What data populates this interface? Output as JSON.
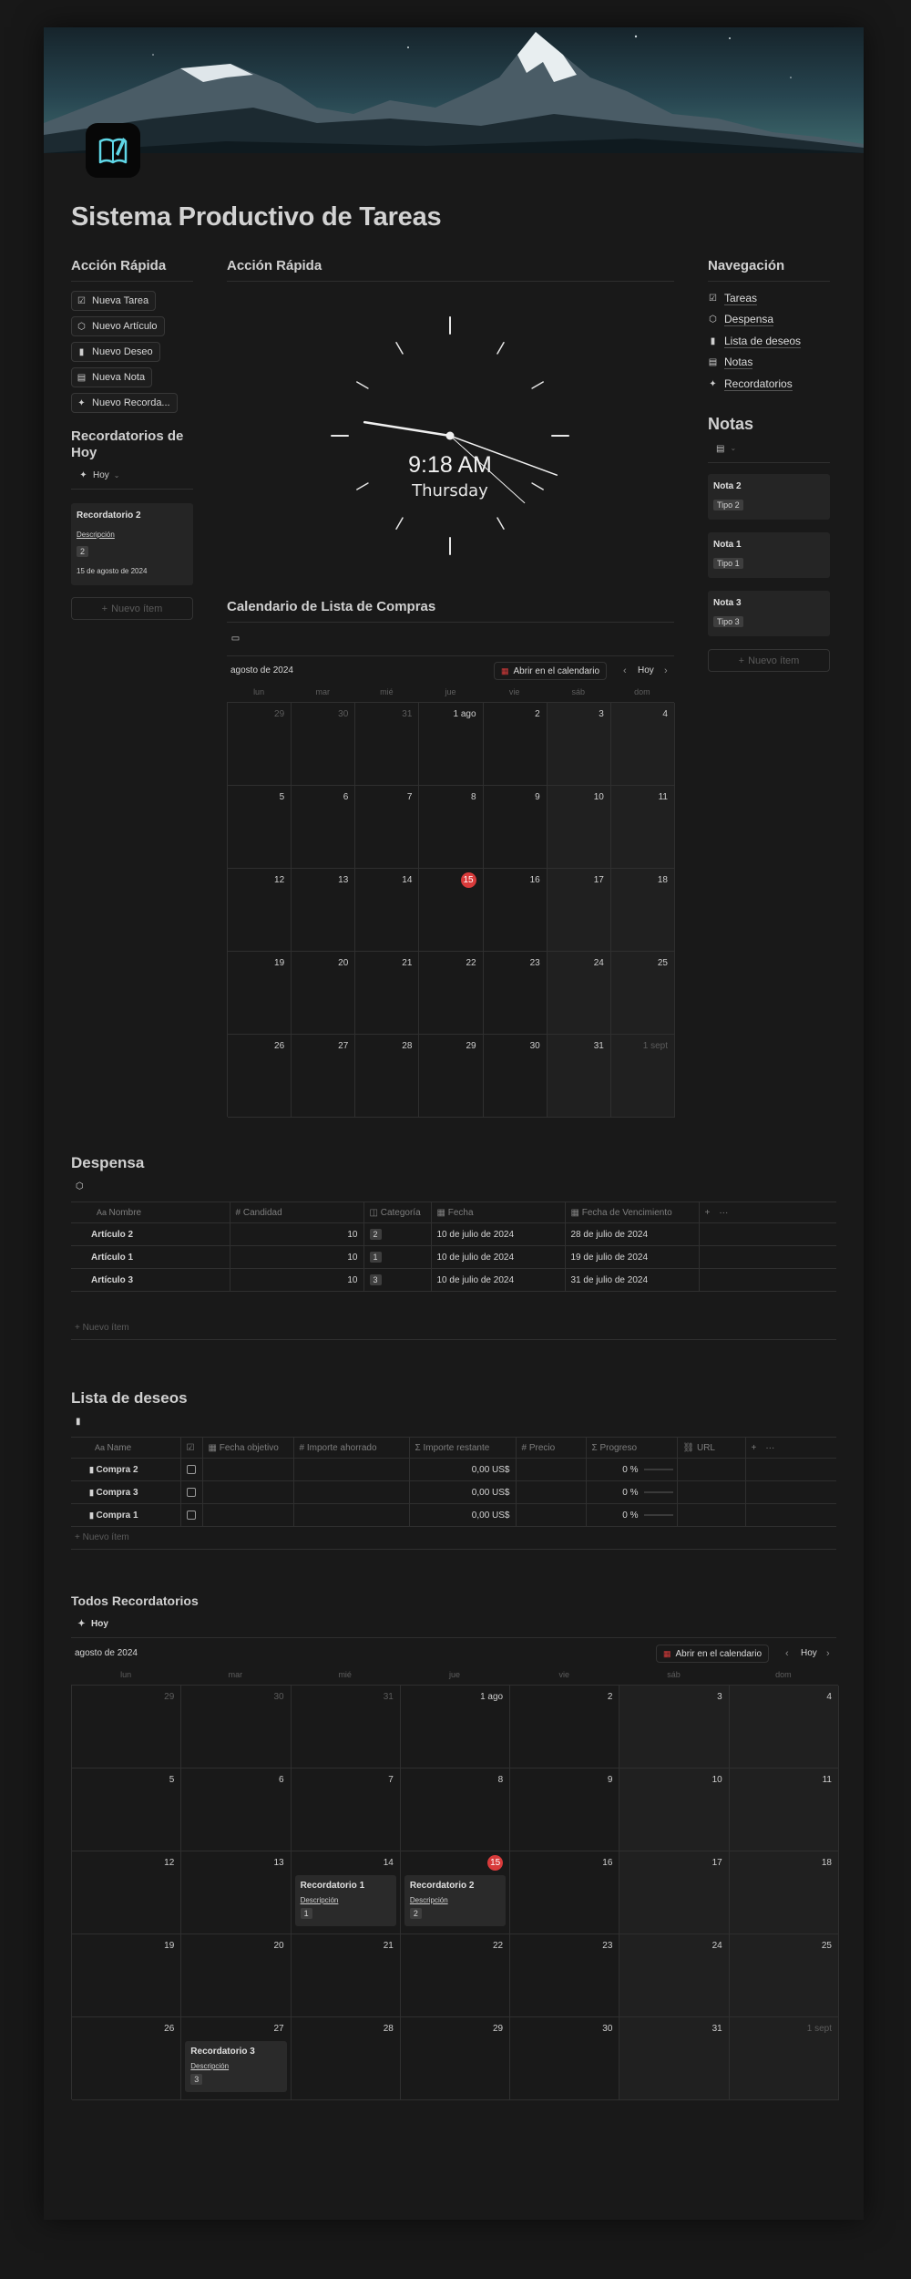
{
  "page": {
    "title": "Sistema Productivo de Tareas"
  },
  "quick_actions": {
    "heading": "Acción Rápida",
    "buttons": [
      {
        "label": "Nueva Tarea",
        "icon": "checkbox-icon"
      },
      {
        "label": "Nuevo Artículo",
        "icon": "box-icon"
      },
      {
        "label": "Nuevo Deseo",
        "icon": "bag-icon"
      },
      {
        "label": "Nueva Nota",
        "icon": "note-icon"
      },
      {
        "label": "Nuevo Recorda...",
        "icon": "reminder-icon"
      }
    ]
  },
  "today_reminders": {
    "heading": "Recordatorios de Hoy",
    "filter": "Hoy",
    "card": {
      "title": "Recordatorio 2",
      "desc_label": "Descripción",
      "badge": "2",
      "date": "15 de agosto de 2024"
    },
    "new_item": "Nuevo ítem"
  },
  "clock": {
    "heading": "Acción Rápida",
    "time": "9:18 AM",
    "day": "Thursday",
    "hour": 9,
    "minute": 18,
    "second": 22
  },
  "navigation": {
    "heading": "Navegación",
    "items": [
      {
        "label": "Tareas",
        "icon": "checkbox-icon"
      },
      {
        "label": "Despensa",
        "icon": "box-icon"
      },
      {
        "label": "Lista de deseos",
        "icon": "bag-icon"
      },
      {
        "label": "Notas",
        "icon": "note-icon"
      },
      {
        "label": "Recordatorios",
        "icon": "reminder-icon"
      }
    ]
  },
  "notes": {
    "heading": "Notas",
    "cards": [
      {
        "title": "Nota 2",
        "tag": "Tipo 2"
      },
      {
        "title": "Nota 1",
        "tag": "Tipo 1"
      },
      {
        "title": "Nota 3",
        "tag": "Tipo 3"
      }
    ],
    "new_item": "Nuevo ítem"
  },
  "shopping_calendar": {
    "heading": "Calendario de Lista de Compras",
    "month": "agosto de 2024",
    "open_btn": "Abrir en el calendario",
    "today_btn": "Hoy",
    "weekdays": [
      "lun",
      "mar",
      "mié",
      "jue",
      "vie",
      "sáb",
      "dom"
    ],
    "days": [
      "29",
      "30",
      "31",
      "1 ago",
      "2",
      "3",
      "4",
      "5",
      "6",
      "7",
      "8",
      "9",
      "10",
      "11",
      "12",
      "13",
      "14",
      "15",
      "16",
      "17",
      "18",
      "19",
      "20",
      "21",
      "22",
      "23",
      "24",
      "25",
      "26",
      "27",
      "28",
      "29",
      "30",
      "31",
      "1 sept"
    ]
  },
  "pantry": {
    "heading": "Despensa",
    "columns": [
      "Nombre",
      "Candidad",
      "Categoría",
      "Fecha",
      "Fecha de Vencimiento"
    ],
    "rows": [
      {
        "name": "Artículo 2",
        "qty": "10",
        "cat": "2",
        "date": "10 de julio de 2024",
        "exp": "28 de julio de 2024"
      },
      {
        "name": "Artículo 1",
        "qty": "10",
        "cat": "1",
        "date": "10 de julio de 2024",
        "exp": "19 de julio de 2024"
      },
      {
        "name": "Artículo 3",
        "qty": "10",
        "cat": "3",
        "date": "10 de julio de 2024",
        "exp": "31 de julio de 2024"
      }
    ],
    "new_item": "Nuevo ítem"
  },
  "wishlist": {
    "heading": "Lista de deseos",
    "columns": [
      "Name",
      "",
      "Fecha objetivo",
      "Importe ahorrado",
      "Importe restante",
      "Precio",
      "Progreso",
      "URL"
    ],
    "rows": [
      {
        "name": "Compra 2",
        "remaining": "0,00 US$",
        "progress": "0 %",
        "progress_value": 0
      },
      {
        "name": "Compra 3",
        "remaining": "0,00 US$",
        "progress": "0 %",
        "progress_value": 0
      },
      {
        "name": "Compra 1",
        "remaining": "0,00 US$",
        "progress": "0 %",
        "progress_value": 0
      }
    ],
    "new_item": "Nuevo ítem"
  },
  "all_reminders": {
    "heading": "Todos Recordatorios",
    "filter": "Hoy",
    "month": "agosto de 2024",
    "open_btn": "Abrir en el calendario",
    "today_btn": "Hoy",
    "weekdays": [
      "lun",
      "mar",
      "mié",
      "jue",
      "vie",
      "sáb",
      "dom"
    ],
    "days": [
      "29",
      "30",
      "31",
      "1 ago",
      "2",
      "3",
      "4",
      "5",
      "6",
      "7",
      "8",
      "9",
      "10",
      "11",
      "12",
      "13",
      "14",
      "15",
      "16",
      "17",
      "18",
      "19",
      "20",
      "21",
      "22",
      "23",
      "24",
      "25",
      "26",
      "27",
      "28",
      "29",
      "30",
      "31",
      "1 sept"
    ],
    "events": [
      {
        "day_index": 16,
        "title": "Recordatorio 1",
        "desc_label": "Descripción",
        "badge": "1"
      },
      {
        "day_index": 17,
        "title": "Recordatorio 2",
        "desc_label": "Descripción",
        "badge": "2"
      },
      {
        "day_index": 29,
        "title": "Recordatorio 3",
        "desc_label": "Descripción",
        "badge": "3"
      }
    ]
  },
  "colors": {
    "accent_red": "#d83b3b",
    "icon_cyan": "#5fd6e6",
    "page_bg": "#191919"
  }
}
